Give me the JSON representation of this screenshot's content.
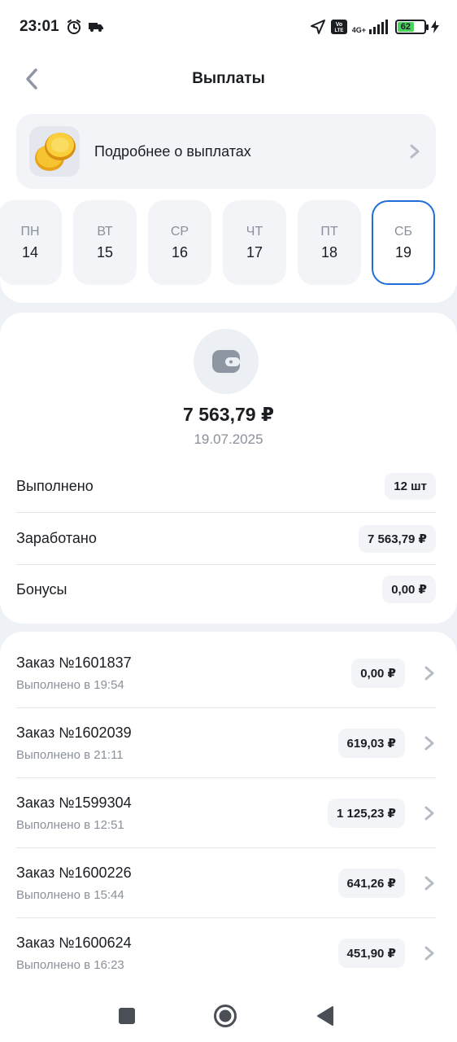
{
  "status_bar": {
    "time": "23:01",
    "network": "4G+",
    "volte": "Vo LTE",
    "battery": "62",
    "battery_level": 0.62
  },
  "header": {
    "title": "Выплаты"
  },
  "info_card": {
    "label": "Подробнее о выплатах"
  },
  "days": [
    {
      "name": "ПН",
      "num": "14",
      "selected": false
    },
    {
      "name": "ВТ",
      "num": "15",
      "selected": false
    },
    {
      "name": "СР",
      "num": "16",
      "selected": false
    },
    {
      "name": "ЧТ",
      "num": "17",
      "selected": false
    },
    {
      "name": "ПТ",
      "num": "18",
      "selected": false
    },
    {
      "name": "СБ",
      "num": "19",
      "selected": true
    }
  ],
  "summary": {
    "total": "7 563,79 ₽",
    "date": "19.07.2025",
    "rows": [
      {
        "label": "Выполнено",
        "value": "12 шт"
      },
      {
        "label": "Заработано",
        "value": "7 563,79 ₽"
      },
      {
        "label": "Бонусы",
        "value": "0,00 ₽"
      }
    ]
  },
  "orders": [
    {
      "title": "Заказ №1601837",
      "sub": "Выполнено в 19:54",
      "amount": "0,00 ₽"
    },
    {
      "title": "Заказ №1602039",
      "sub": "Выполнено в 21:11",
      "amount": "619,03 ₽"
    },
    {
      "title": "Заказ №1599304",
      "sub": "Выполнено в 12:51",
      "amount": "1 125,23 ₽"
    },
    {
      "title": "Заказ №1600226",
      "sub": "Выполнено в 15:44",
      "amount": "641,26 ₽"
    },
    {
      "title": "Заказ №1600624",
      "sub": "Выполнено в 16:23",
      "amount": "451,90 ₽"
    }
  ],
  "colors": {
    "accent": "#1f6fd6",
    "background": "#eef1f6",
    "card": "#f2f4f8",
    "muted_text": "#8a909b",
    "battery": "#4bd15f"
  }
}
